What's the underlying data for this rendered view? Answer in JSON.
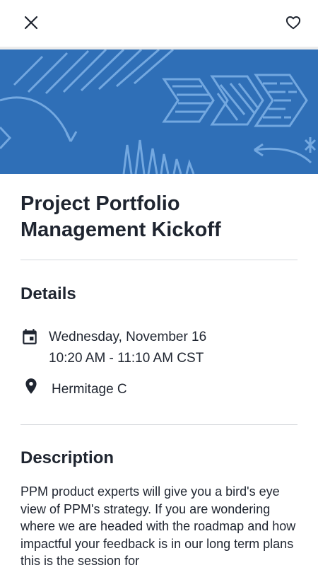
{
  "header": {
    "close_icon": "close-icon",
    "favorite_icon": "heart-outline-icon"
  },
  "hero": {
    "background_color": "#2f6fb7",
    "accent_color": "#7fb2e8"
  },
  "event": {
    "title": "Project Portfolio Management Kickoff"
  },
  "details": {
    "heading": "Details",
    "date_icon": "calendar-icon",
    "date_line": "Wednesday, November 16",
    "time_line": "10:20 AM - 11:10 AM CST",
    "location_icon": "location-pin-icon",
    "location": "Hermitage C"
  },
  "description": {
    "heading": "Description",
    "body": "PPM product experts will give you a bird's eye view of PPM's strategy. If you are wondering where we are headed with the roadmap and how impactful your feedback is in our long term plans this is the session for"
  }
}
